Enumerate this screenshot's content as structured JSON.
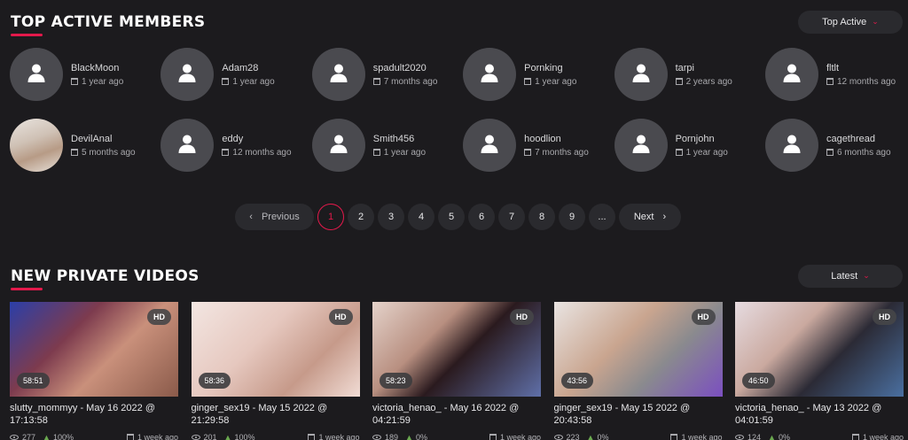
{
  "members_section": {
    "title": "TOP ACTIVE MEMBERS",
    "sort_label": "Top Active",
    "members": [
      {
        "name": "BlackMoon",
        "time": "1 year ago",
        "photo": false
      },
      {
        "name": "Adam28",
        "time": "1 year ago",
        "photo": false
      },
      {
        "name": "spadult2020",
        "time": "7 months ago",
        "photo": false
      },
      {
        "name": "Pornking",
        "time": "1 year ago",
        "photo": false
      },
      {
        "name": "tarpi",
        "time": "2 years ago",
        "photo": false
      },
      {
        "name": "fltlt",
        "time": "12 months ago",
        "photo": false
      },
      {
        "name": "DevilAnal",
        "time": "5 months ago",
        "photo": true
      },
      {
        "name": "eddy",
        "time": "12 months ago",
        "photo": false
      },
      {
        "name": "Smith456",
        "time": "1 year ago",
        "photo": false
      },
      {
        "name": "hoodlion",
        "time": "7 months ago",
        "photo": false
      },
      {
        "name": "Pornjohn",
        "time": "1 year ago",
        "photo": false
      },
      {
        "name": "cagethread",
        "time": "6 months ago",
        "photo": false
      }
    ]
  },
  "pagination": {
    "previous_label": "Previous",
    "next_label": "Next",
    "pages": [
      "1",
      "2",
      "3",
      "4",
      "5",
      "6",
      "7",
      "8",
      "9",
      "..."
    ],
    "current": "1"
  },
  "videos_section": {
    "title": "NEW PRIVATE VIDEOS",
    "sort_label": "Latest",
    "videos": [
      {
        "title": "slutty_mommyy - May 16 2022 @ 17:13:58",
        "duration": "58:51",
        "badge": "HD",
        "views": "277",
        "rating": "100%",
        "age": "1 week ago",
        "bg": "linear-gradient(135deg,#2b3fa8 0%,#7d3b4e 35%,#c9907b 60%,#8a5a4a 100%)"
      },
      {
        "title": "ginger_sex19 - May 15 2022 @ 21:29:58",
        "duration": "58:36",
        "badge": "HD",
        "views": "201",
        "rating": "100%",
        "age": "1 week ago",
        "bg": "linear-gradient(135deg,#f3e6e2 0%,#e6c8bf 40%,#c69a8a 70%,#f1dcd5 100%)"
      },
      {
        "title": "victoria_henao_ - May 16 2022 @ 04:21:59",
        "duration": "58:23",
        "badge": "HD",
        "views": "189",
        "rating": "0%",
        "age": "1 week ago",
        "bg": "linear-gradient(135deg,#e4d2ca 0%,#b88f80 35%,#2a1a1e 55%,#5f6fa8 100%)"
      },
      {
        "title": "ginger_sex19 - May 15 2022 @ 20:43:58",
        "duration": "43:56",
        "badge": "HD",
        "views": "223",
        "rating": "0%",
        "age": "1 week ago",
        "bg": "linear-gradient(135deg,#e9e4e2 0%,#c9a58f 40%,#8a8a8e 65%,#7b4fc0 100%)"
      },
      {
        "title": "victoria_henao_ - May 13 2022 @ 04:01:59",
        "duration": "46:50",
        "badge": "HD",
        "views": "124",
        "rating": "0%",
        "age": "1 week ago",
        "bg": "linear-gradient(135deg,#e6dbe0 0%,#caa99f 35%,#2b2a35 60%,#4a6fa0 100%)"
      }
    ]
  }
}
